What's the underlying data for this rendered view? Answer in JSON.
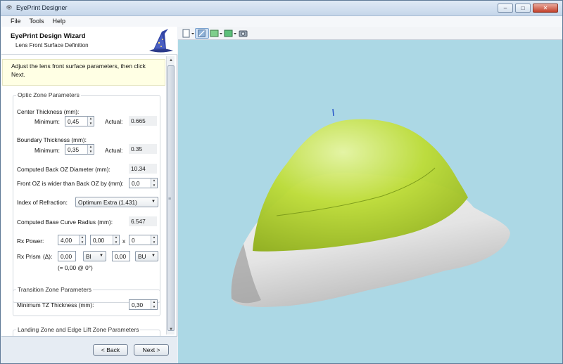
{
  "window": {
    "title": "EyePrint Designer",
    "minimize": "–",
    "maximize": "□",
    "close": "✕"
  },
  "menu": [
    "File",
    "Tools",
    "Help"
  ],
  "wizard": {
    "title": "EyePrint Design Wizard",
    "subtitle": "Lens Front Surface Definition",
    "instructions": "Adjust the lens front surface parameters, then click Next."
  },
  "optic_zone": {
    "title": "Optic Zone Parameters",
    "center_thickness_label": "Center Thickness (mm):",
    "minimum_label": "Minimum:",
    "actual_label": "Actual:",
    "center_min": "0,45",
    "center_actual": "0.665",
    "boundary_thickness_label": "Boundary Thickness (mm):",
    "boundary_min": "0,35",
    "boundary_actual": "0.35",
    "computed_back_label": "Computed Back OZ Diameter (mm):",
    "computed_back": "10.34",
    "front_oz_label": "Front OZ is wider than Back OZ by (mm):",
    "front_oz": "0,0",
    "refraction_label": "Index of Refraction:",
    "refraction": "Optimum Extra (1.431)",
    "base_curve_label": "Computed Base Curve Radius (mm):",
    "base_curve": "6.547",
    "rx_power_label": "Rx Power:",
    "rx_power_1": "4,00",
    "rx_power_2": "0,00",
    "rx_power_x": "x",
    "rx_power_3": "0",
    "rx_prism_label": "Rx Prism",
    "rx_prism_symbol": "(Δ):",
    "rx_prism_1": "0,00",
    "rx_prism_dir1": "BI",
    "rx_prism_2": "0,00",
    "rx_prism_dir2": "BU",
    "rx_prism_result": "(= 0,00 @ 0°)"
  },
  "transition_zone": {
    "title": "Transition Zone Parameters",
    "min_tz_label": "Minimum TZ Thickness (mm):",
    "min_tz": "0,30"
  },
  "landing_zone": {
    "title": "Landing Zone and Edge Lift Zone Parameters"
  },
  "footer": {
    "back": "< Back",
    "next": "Next >"
  },
  "toolbar": {
    "icons": [
      "new-view-icon",
      "shaded-view-icon",
      "surface-color-icon",
      "display-mode-icon",
      "camera-icon"
    ]
  },
  "colors": {
    "viewport_bg": "#acd8e5",
    "lens_green": "#b9dc33",
    "scleral_white": "#f0f0f0"
  }
}
